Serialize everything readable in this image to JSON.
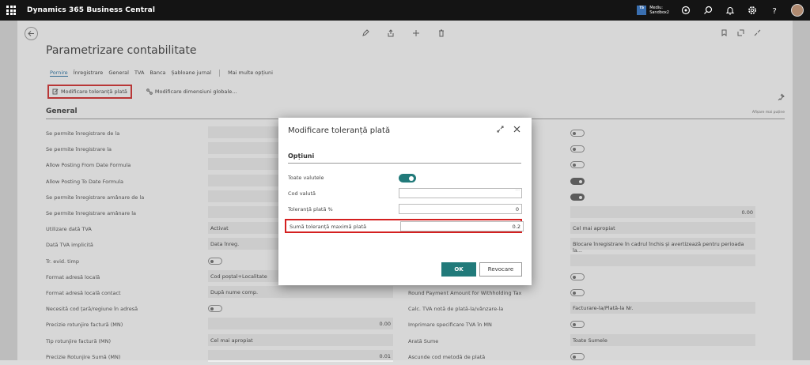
{
  "topbar": {
    "brand": "Dynamics 365 Business Central",
    "env_badge": "TS",
    "env_line1": "Mediu:",
    "env_line2": "Sandbox2"
  },
  "page": {
    "title": "Parametrizare contabilitate",
    "tabs": [
      {
        "label": "Pornire"
      },
      {
        "label": "Înregistrare"
      },
      {
        "label": "General"
      },
      {
        "label": "TVA"
      },
      {
        "label": "Banca"
      },
      {
        "label": "Șabloane jurnal"
      },
      {
        "label": "Mai multe opțiuni"
      }
    ],
    "actions": {
      "modify_tolerance": "Modificare toleranță plată",
      "modify_dimensions": "Modificare dimensiuni globale..."
    },
    "section": "General",
    "show_less": "Afișare mai puține"
  },
  "left_fields": [
    {
      "label": "Se permite înregistrare de la",
      "type": "field",
      "value": ""
    },
    {
      "label": "Se permite înregistrare la",
      "type": "field",
      "value": ""
    },
    {
      "label": "Allow Posting From Date Formula",
      "type": "field",
      "value": ""
    },
    {
      "label": "Allow Posting To Date Formula",
      "type": "field",
      "value": ""
    },
    {
      "label": "Se permite înregistrare amânare de la",
      "type": "field",
      "value": ""
    },
    {
      "label": "Se permite înregistrare amânare la",
      "type": "field",
      "value": ""
    },
    {
      "label": "Utilizare dată TVA",
      "type": "field",
      "value": "Activat"
    },
    {
      "label": "Dată TVA implicită",
      "type": "field",
      "value": "Data înreg."
    },
    {
      "label": "Tr. evid. timp",
      "type": "toggle",
      "on": false
    },
    {
      "label": "Format adresă locală",
      "type": "field",
      "value": "Cod poștal+Localitate"
    },
    {
      "label": "Format adresă locală contact",
      "type": "field",
      "value": "După nume comp."
    },
    {
      "label": "Necesită cod țară/regiune în adresă",
      "type": "toggle",
      "on": false
    },
    {
      "label": "Precizie rotunjire factură (MN)",
      "type": "field",
      "value": "0.00",
      "right": true
    },
    {
      "label": "Tip rotunjire factură (MN)",
      "type": "field",
      "value": "Cel mai apropiat"
    },
    {
      "label": "Precizie Rotunjire Sumă (MN)",
      "type": "field",
      "value": "0.01",
      "right": true
    }
  ],
  "right_fields": [
    {
      "label": "",
      "type": "toggle",
      "on": false
    },
    {
      "label": "",
      "type": "toggle",
      "on": false
    },
    {
      "label": "",
      "type": "toggle",
      "on": false
    },
    {
      "label": "",
      "type": "toggle",
      "on": true
    },
    {
      "label": "",
      "type": "toggle",
      "on": true
    },
    {
      "label": "",
      "type": "field",
      "value": "0.00",
      "right": true
    },
    {
      "label": "",
      "type": "field",
      "value": "Cel mai apropiat"
    },
    {
      "label": "",
      "type": "field",
      "value": "Blocare înregistrare în cadrul închis și avertizează pentru perioada la..."
    },
    {
      "label": "",
      "type": "field",
      "value": ""
    },
    {
      "label": "",
      "type": "toggle",
      "on": false
    },
    {
      "label": "Round Payment Amount for Withholding Tax",
      "type": "toggle",
      "on": false
    },
    {
      "label": "Calc. TVA notă de plată-la/vânzare-la",
      "type": "field",
      "value": "Facturare-la/Plată-la Nr."
    },
    {
      "label": "Imprimare specificare TVA în MN",
      "type": "toggle",
      "on": false
    },
    {
      "label": "Arată Sume",
      "type": "field",
      "value": "Toate Sumele"
    },
    {
      "label": "Ascunde cod metodă de plată",
      "type": "toggle",
      "on": false
    }
  ],
  "dialog": {
    "title": "Modificare toleranță plată",
    "group": "Opțiuni",
    "all_currencies_label": "Toate valutele",
    "currency_code_label": "Cod valută",
    "currency_code_value": "",
    "tolerance_pct_label": "Toleranță plată %",
    "tolerance_pct_value": "0",
    "max_amount_label": "Sumă toleranță maximă plată",
    "max_amount_value": "0.2",
    "ok": "OK",
    "cancel": "Revocare"
  }
}
